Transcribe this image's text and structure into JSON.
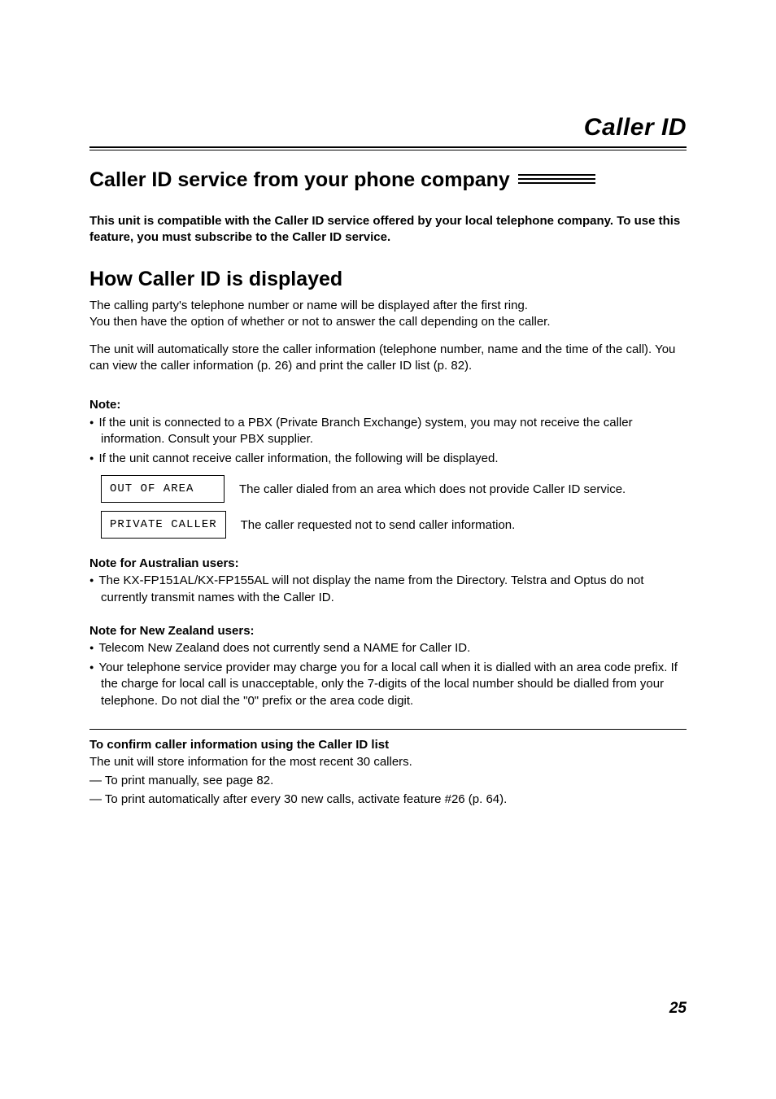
{
  "chapter": {
    "title": "Caller ID"
  },
  "section": {
    "title": "Caller ID service from your phone company"
  },
  "intro": "This unit is compatible with the Caller ID service offered by your local telephone company. To use this feature, you must subscribe to the Caller ID service.",
  "subhead": "How Caller ID is displayed",
  "para1a": "The calling party's telephone number or name will be displayed after the first ring.",
  "para1b": "You then have the option of whether or not to answer the call depending on the caller.",
  "para2": "The unit will automatically store the caller information (telephone number, name and the time of the call). You can view the caller information (p. 26) and print the caller ID list (p. 82).",
  "note": {
    "label": "Note:",
    "b1": "If the unit is connected to a PBX (Private Branch Exchange) system, you may not receive the caller information. Consult your PBX supplier.",
    "b2": "If the unit cannot receive caller information, the following will be displayed."
  },
  "displays": {
    "d1": {
      "code": "OUT OF AREA",
      "desc": "The caller dialed from an area which does not provide Caller ID service."
    },
    "d2": {
      "code": "PRIVATE CALLER",
      "desc": "The caller requested not to send caller information."
    }
  },
  "aus": {
    "heading": "Note for Australian users:",
    "b1": "The KX-FP151AL/KX-FP155AL will not display the name from the Directory. Telstra and Optus do not currently transmit names with the Caller ID."
  },
  "nz": {
    "heading": "Note for New Zealand users:",
    "b1": "Telecom New Zealand does not currently send a NAME for Caller ID.",
    "b2": "Your telephone service provider may charge you for a local call when it is dialled with an area code prefix. If the charge for local call is unacceptable, only the 7-digits of the local number should be dialled from your telephone. Do not dial the \"0\" prefix or the area code digit."
  },
  "confirm": {
    "heading": "To confirm caller information using the Caller ID list",
    "line1": "The unit will store information for the most recent 30 callers.",
    "line2": "— To print manually, see page 82.",
    "line3": "— To print automatically after every 30 new calls, activate feature #26 (p. 64)."
  },
  "page_number": "25"
}
